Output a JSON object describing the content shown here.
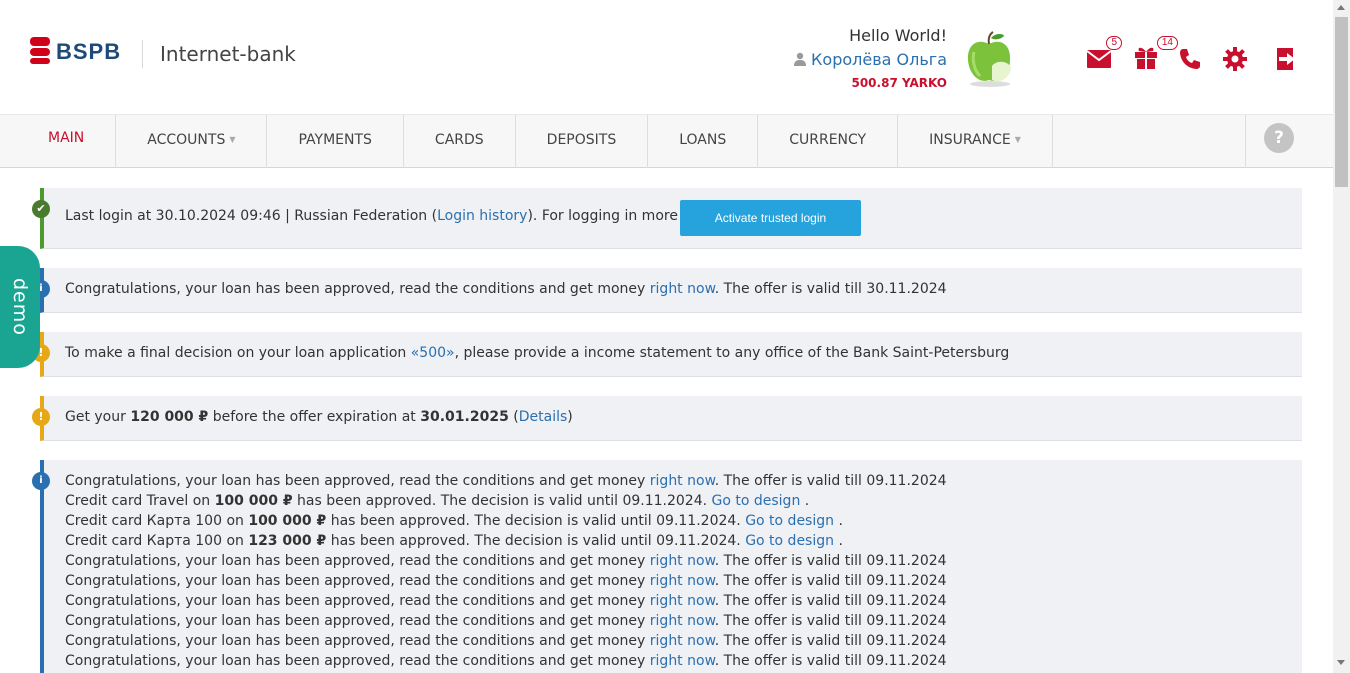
{
  "header": {
    "logo_text": "BSPB",
    "logo_subtitle": "Internet-bank",
    "greeting": "Hello World!",
    "user_name": "Королёва Ольга",
    "balance": "500.87 YARKO",
    "messages_count": "5",
    "gifts_count": "14"
  },
  "nav": {
    "items": [
      {
        "label": "MAIN",
        "dropdown": false
      },
      {
        "label": "ACCOUNTS",
        "dropdown": true
      },
      {
        "label": "PAYMENTS",
        "dropdown": false
      },
      {
        "label": "CARDS",
        "dropdown": false
      },
      {
        "label": "DEPOSITS",
        "dropdown": false
      },
      {
        "label": "LOANS",
        "dropdown": false
      },
      {
        "label": "CURRENCY",
        "dropdown": false
      },
      {
        "label": "INSURANCE",
        "dropdown": true
      }
    ],
    "help": "?"
  },
  "demo_tab": "demo",
  "notice1": {
    "text1": "Last login at 30.10.2024 09:46 | Russian Federation (",
    "link": "Login history",
    "text2": "). For logging in more quickly",
    "button": "Activate trusted login"
  },
  "notice2": {
    "text1": "Congratulations, your loan has been approved, read the conditions and get money ",
    "link": "right now",
    "text2": ". The offer is valid till 30.11.2024"
  },
  "notice3": {
    "text1": "To make a final decision on your loan application ",
    "link": "«500»",
    "text2": ", please provide a income statement to any office of the Bank Saint-Petersburg"
  },
  "notice4": {
    "text1": "Get your ",
    "amount": "120 000 ₽",
    "text2": " before the offer expiration at ",
    "date": "30.01.2025",
    "text3": " (",
    "link": "Details",
    "text4": ")"
  },
  "notice5": {
    "loan_text": "Congratulations, your loan has been approved, read the conditions and get money ",
    "loan_link": "right now",
    "loan_valid": ". The offer is valid till 09.11.2024",
    "card1_prefix": "Credit card Travel on ",
    "card1_amount": "100 000 ₽",
    "card2_prefix": "Credit card Карта 100 on ",
    "card2_amount": "100 000 ₽",
    "card3_prefix": "Credit card Карта 100 on ",
    "card3_amount": "123 000 ₽",
    "card_suffix": " has been approved. The decision is valid until 09.11.2024. ",
    "card_link": "Go to design",
    "card_end": " ."
  },
  "colors": {
    "brand_red": "#c8102e",
    "link_blue": "#2a6fb0",
    "button_blue": "#26a3dd",
    "demo_teal": "#1aa593"
  }
}
